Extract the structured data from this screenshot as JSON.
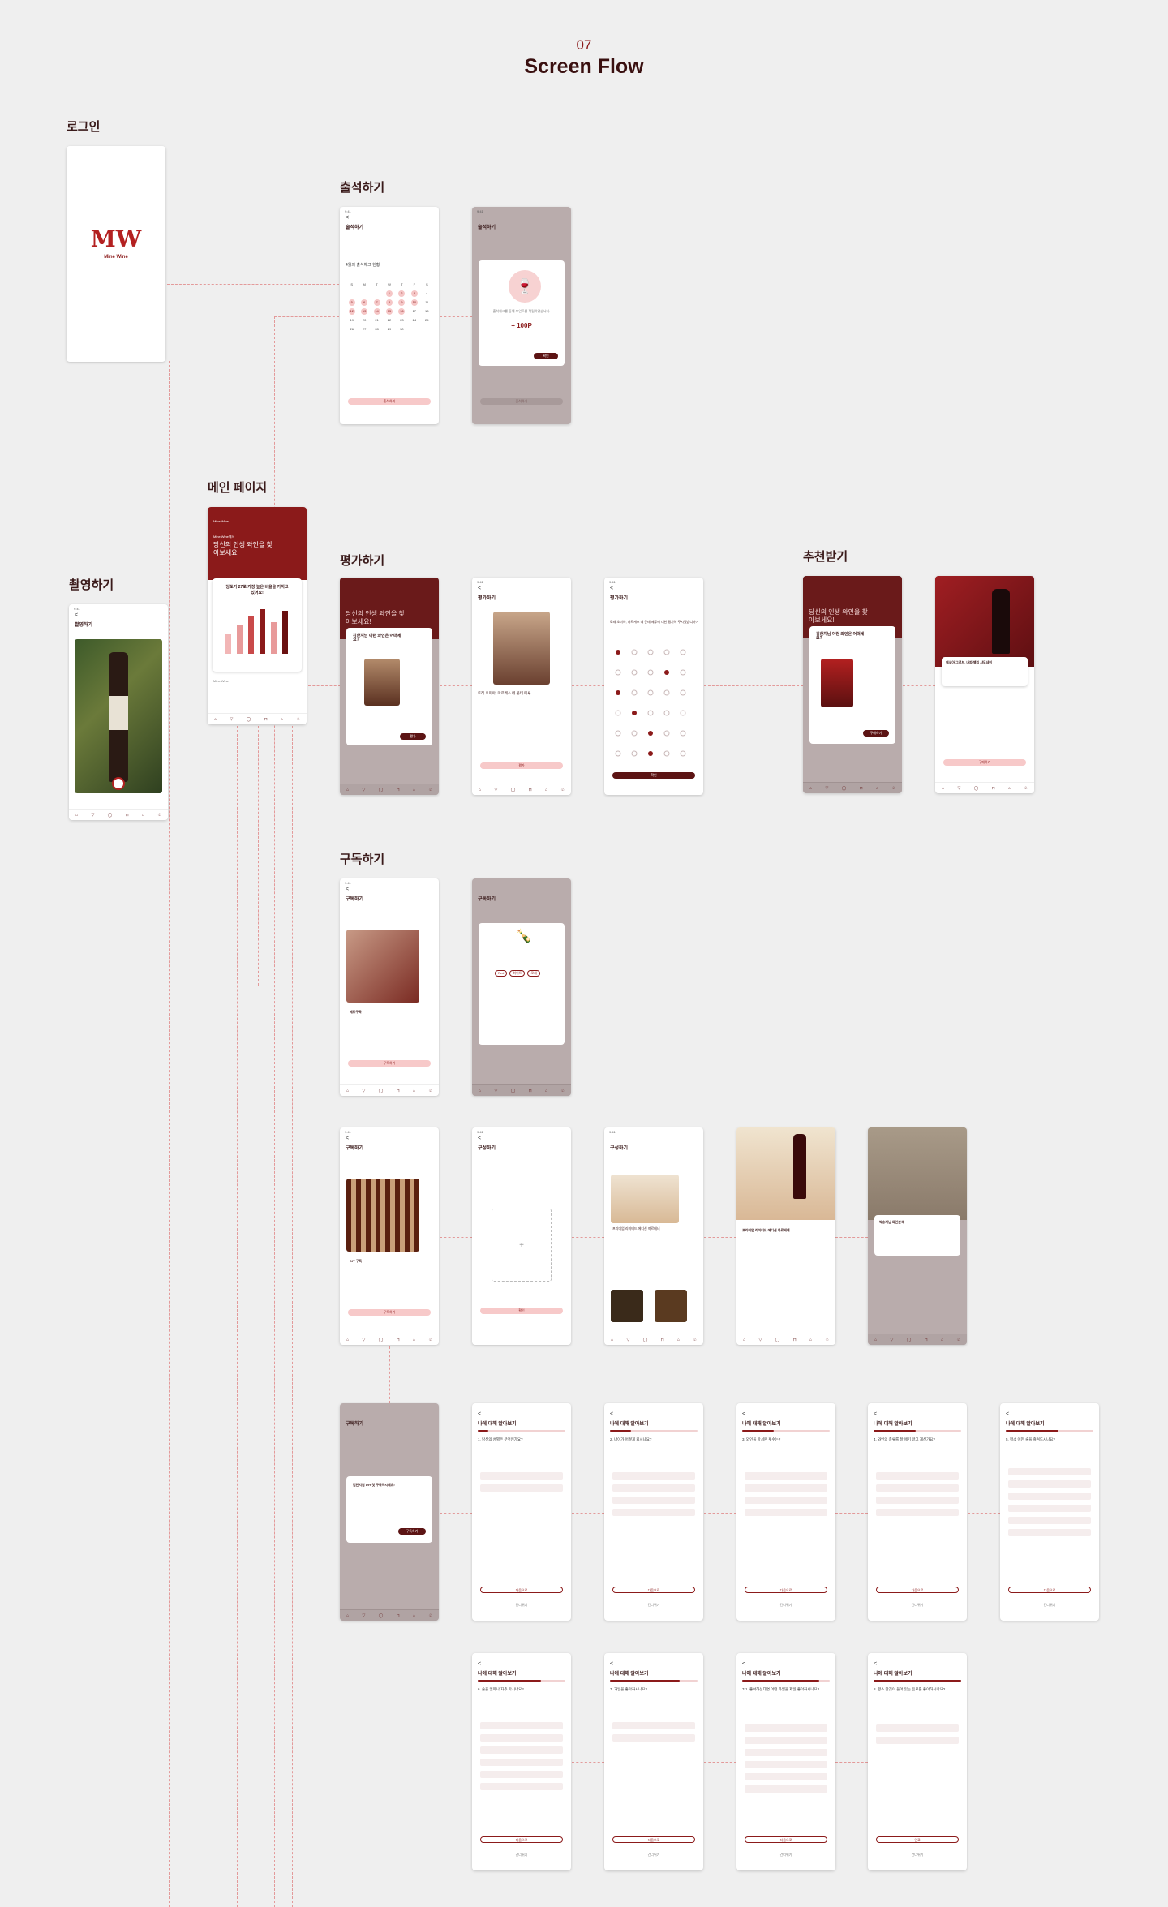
{
  "header": {
    "number": "07",
    "title": "Screen Flow"
  },
  "sections": {
    "login": "로그인",
    "checkin": "출석하기",
    "main": "메인 페이지",
    "capture": "촬영하기",
    "rate": "평가하기",
    "recommend": "추천받기",
    "subscribe": "구독하기"
  },
  "brand": {
    "logo_text": "Mine Wine",
    "color": "#8b1a1a"
  },
  "common": {
    "status_time": "9:41",
    "back": "<"
  },
  "checkin": {
    "title": "출석하기",
    "month_label": "4월의 출석체크 현황",
    "weekdays": [
      "S",
      "M",
      "T",
      "W",
      "T",
      "F",
      "S"
    ],
    "button": "출석하기",
    "modal_text": "출석체크를 통해 포인트를 적립하였습니다.",
    "points": "+ 100P",
    "confirm": "확인"
  },
  "main_page": {
    "brand": "Mine Wine",
    "subtitle": "Mine Wine에서",
    "headline": "당신의 인생 와인을 찾아보세요!",
    "card_title": "당도가 27로 가장 높은 비율을 가지고 있어요!",
    "chart_labels": [
      "최고",
      "매너",
      "평상",
      "고이니",
      "경도",
      "편삼"
    ]
  },
  "capture": {
    "title": "촬영하기"
  },
  "rate": {
    "title": "평가하기",
    "modal_title": "김한지님 이런 와인은 어떠세요?",
    "wine_name": "토레 오미아, 마르케스 데 몬테 메루",
    "button": "평가",
    "survey_q": "토레 오미아, 마르케스 데 몬테 메루에 대한 평가해 주시겠습니까?",
    "survey_button": "확인"
  },
  "recommend": {
    "title": "추천받기",
    "wine_name": "에코아 그로브, 나파 밸리 샤도네이",
    "button": "구매하기"
  },
  "subscribe": {
    "title": "구독하기",
    "set_label": "세트구독",
    "diy_label": "DIY 구독",
    "button": "구독하기",
    "compose_title": "구성하기",
    "compose_button": "확인",
    "product_name": "프리미엄 리미티드 에디션 까르베네",
    "purchase_button": "구매하기",
    "analysis_title": "박승재님 와인분석",
    "diy_modal": "김한지님 DIY 첫 구독하시네요!",
    "tags": [
      "Red",
      "화이트",
      "로제"
    ]
  },
  "survey": {
    "title": "나에 대해 알아보기",
    "next": "다음으로",
    "skip": "건너뛰기",
    "submit": "완료",
    "questions": [
      "1. 당신의 성별은 무엇인가요?",
      "2. 나이가 어떻게 되시나요?",
      "3. 와인을 마셔본 횟수는?",
      "4. 와인의 종류를 잘 애기 알고 계신가요?",
      "5. 평소 어떤 술을 즐겨드시나요?",
      "6. 술을 얼마나 자주 마시나요?",
      "7. 과일을 좋아하시나요?",
      "7-1. 좋아하신다면 어떤 과일을 제일 좋아하시나요?",
      "8. 평소 단것이 들어 있는 음료를 좋아하시나요?"
    ]
  }
}
